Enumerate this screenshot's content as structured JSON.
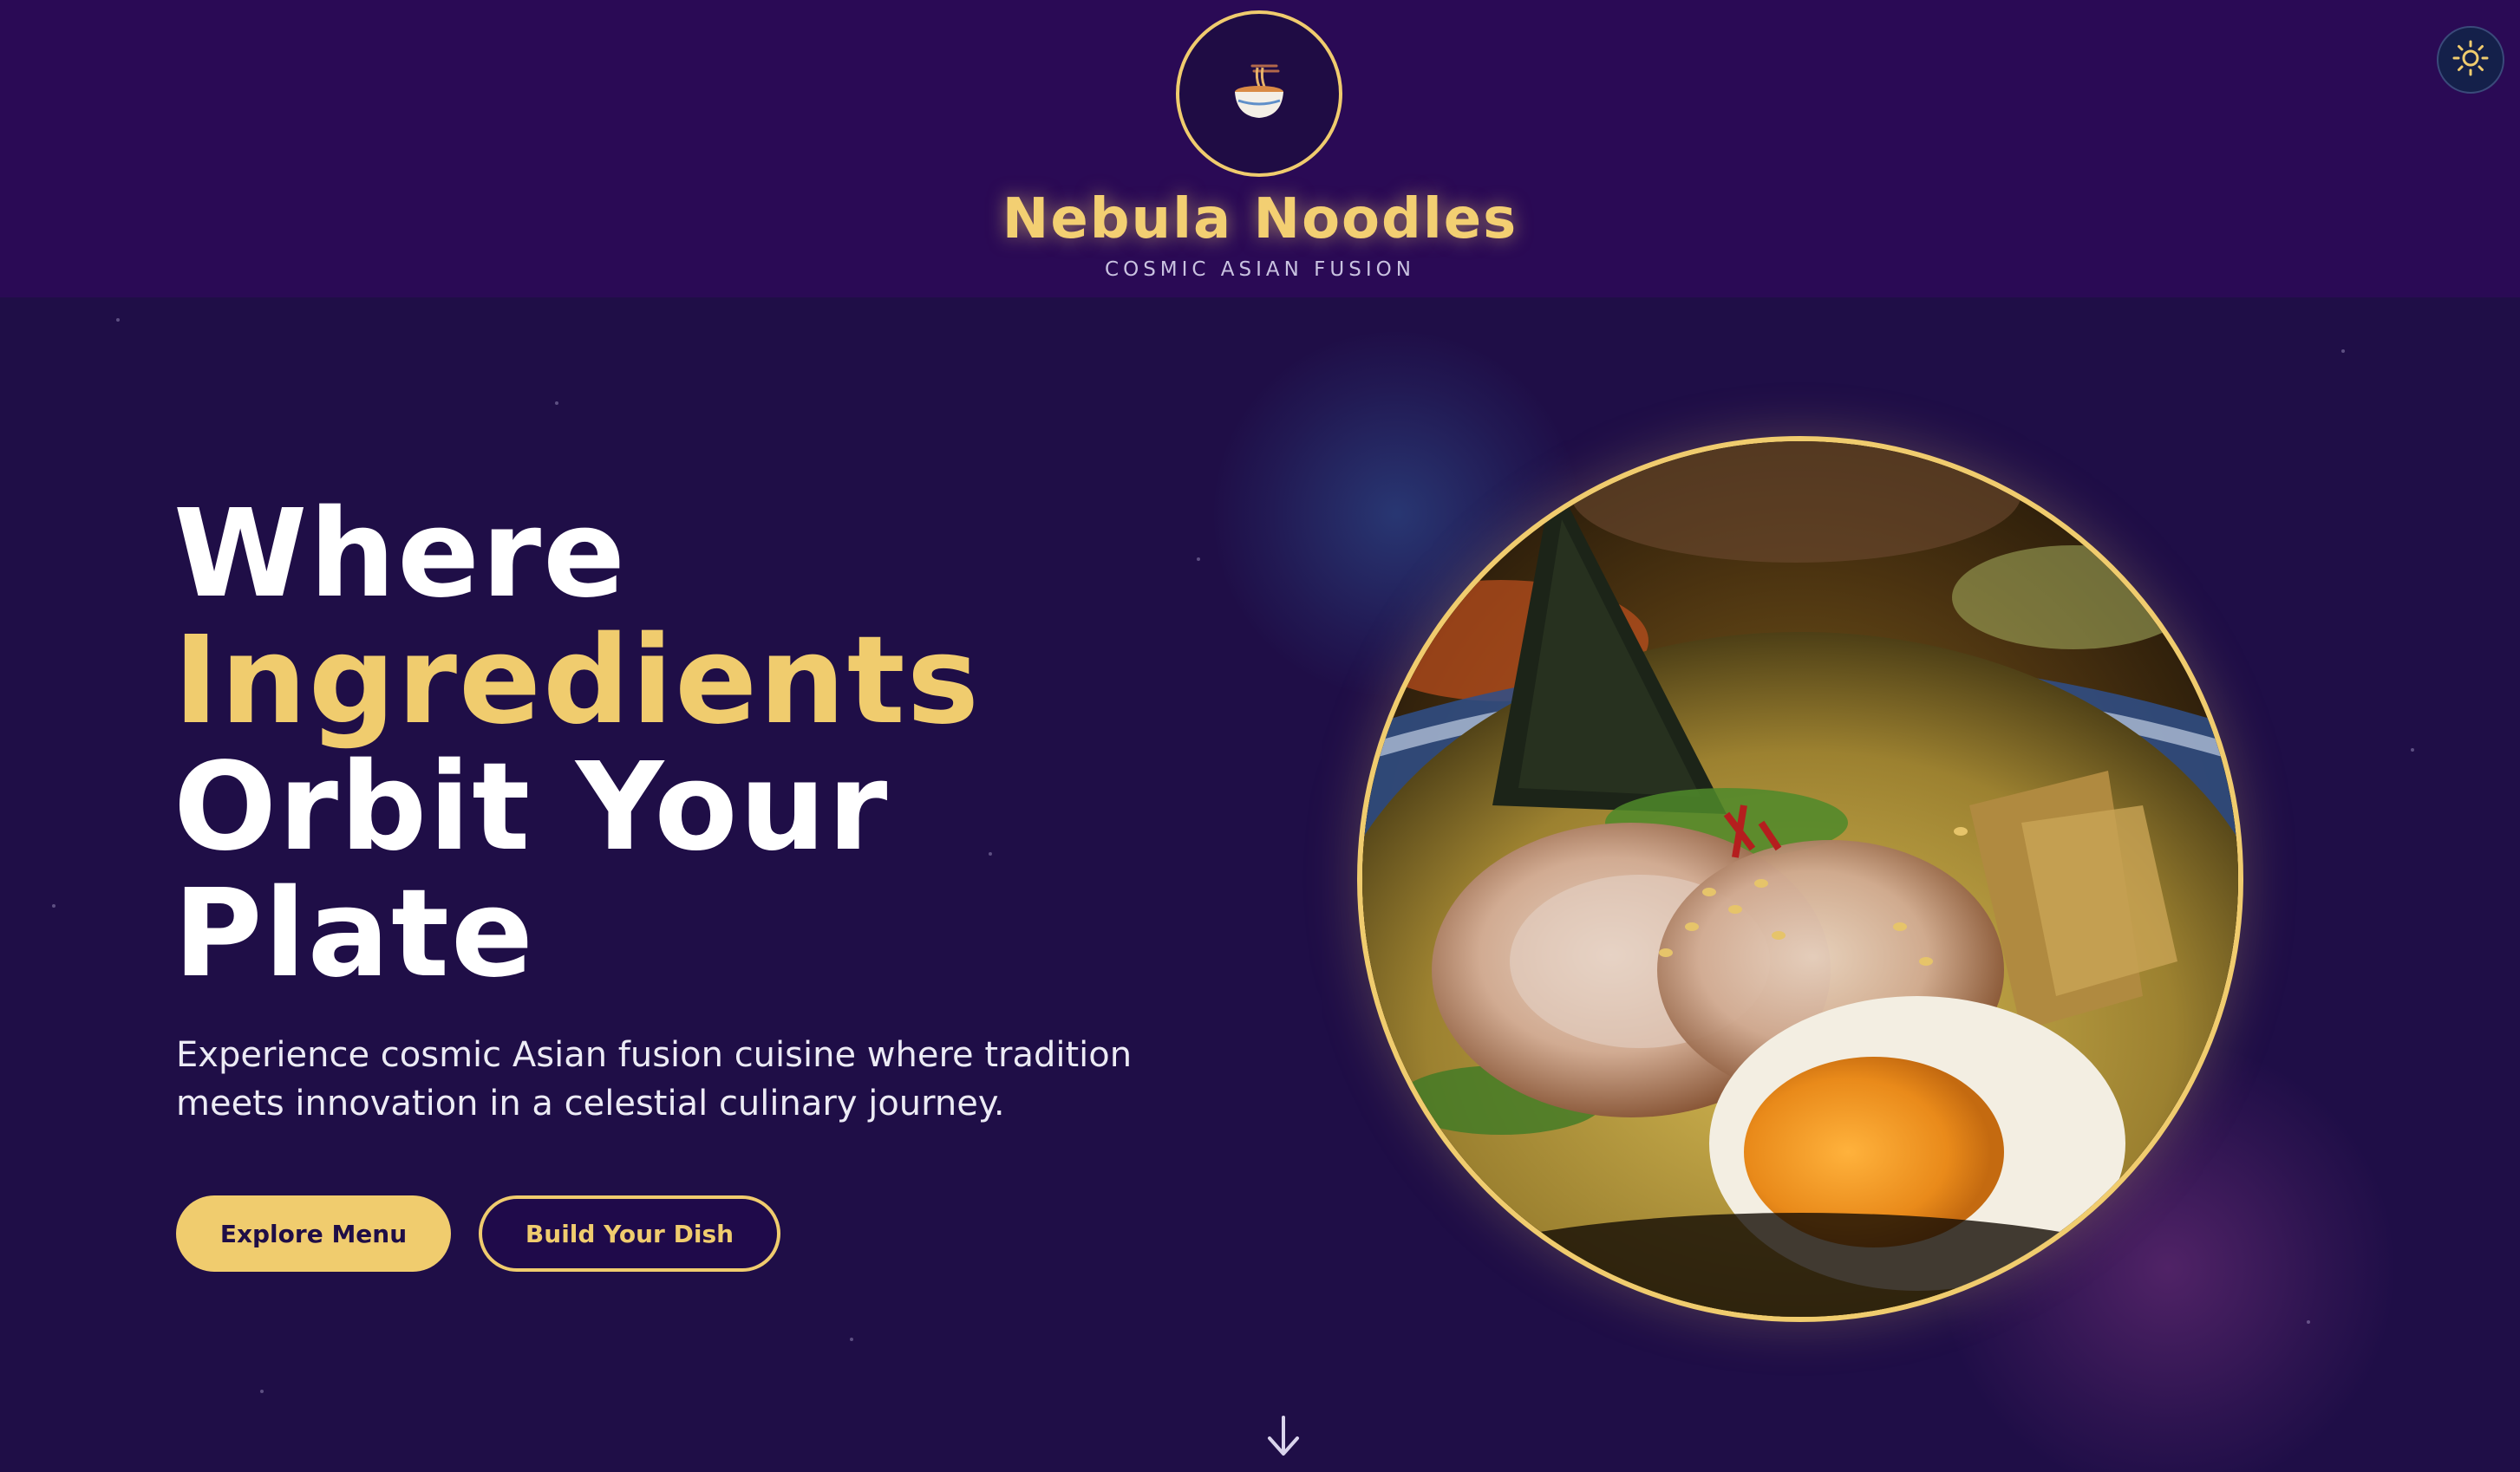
{
  "header": {
    "logo_icon": "noodle-bowl-icon",
    "brand_name": "Nebula Noodles",
    "tagline": "COSMIC ASIAN FUSION",
    "theme_toggle_icon": "sun-icon"
  },
  "hero": {
    "headline": {
      "line1": "Where",
      "line2": "Ingredients",
      "line3": "Orbit Your",
      "line4": "Plate"
    },
    "lead": "Experience cosmic Asian fusion cuisine where tradition meets innovation in a celestial culinary journey.",
    "primary_cta": "Explore Menu",
    "secondary_cta": "Build Your Dish",
    "dish_image": "ramen-bowl-image",
    "scroll_icon": "arrow-down-icon"
  },
  "colors": {
    "accent": "#f0cc6e",
    "header_bg": "#2a0a55",
    "hero_bg": "#1f0e47",
    "text": "#ffffff"
  }
}
